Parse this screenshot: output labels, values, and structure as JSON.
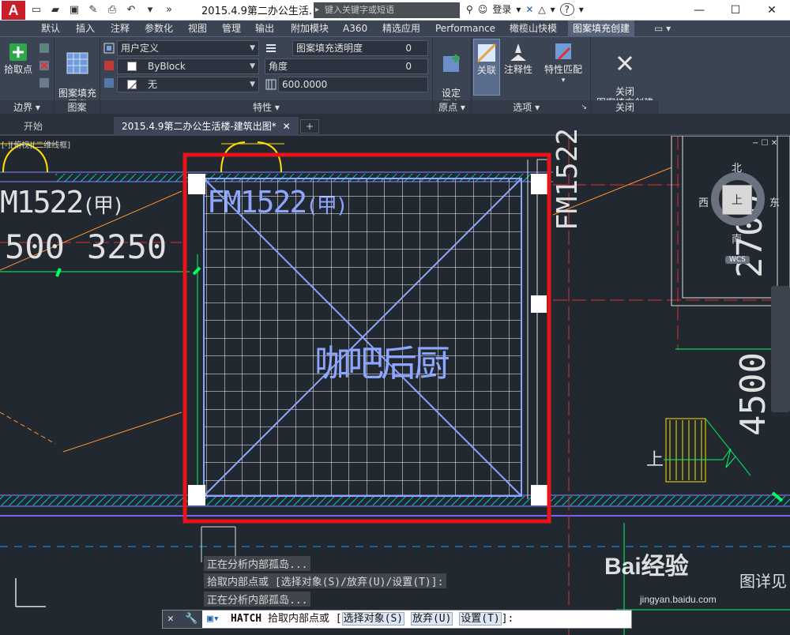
{
  "title_bar": {
    "app_logo": "A",
    "document_title": "2015.4.9第二办公生活...",
    "search_placeholder": "键入关键字或短语",
    "login_label": "登录",
    "help_label": "?"
  },
  "ribbon_tabs": [
    "默认",
    "插入",
    "注释",
    "参数化",
    "视图",
    "管理",
    "输出",
    "附加模块",
    "A360",
    "精选应用",
    "Performance",
    "橄榄山快模",
    "图案填充创建"
  ],
  "active_ribbon_tab": "图案填充创建",
  "ribbon": {
    "boundary": {
      "pick_points_label": "拾取点",
      "panel_label": "边界"
    },
    "pattern": {
      "hatch_pattern_label": "图案填充\n图案",
      "panel_label": "图案"
    },
    "properties": {
      "pattern_type": "用户定义",
      "color": "ByBlock",
      "background": "无",
      "transparency_label": "图案填充透明度",
      "transparency_value": "0",
      "angle_label": "角度",
      "angle_value": "0",
      "spacing_value": "600.0000",
      "panel_label": "特性"
    },
    "origin": {
      "set_origin_label": "设定\n原点",
      "panel_label": "原点"
    },
    "options": {
      "associative_label": "关联",
      "annotative_label": "注释性",
      "match_properties_label": "特性匹配",
      "panel_label": "选项"
    },
    "close": {
      "close_label": "关闭\n图案填充创建",
      "panel_label": "关闭"
    }
  },
  "document_tabs": {
    "start_tab": "开始",
    "active_tab": "2015.4.9第二办公生活楼-建筑出图*"
  },
  "viewport_label": "[-][俯视][二维线框]",
  "drawing": {
    "door_label_main": "FM1522",
    "door_label_main_suffix": "(甲)",
    "door_label_left": "M1522",
    "door_label_left_suffix": "(甲)",
    "dim_left_1": "500",
    "dim_left_2": "3250",
    "room_name": "咖吧后厨",
    "door_label_right": "FM1522",
    "dim_right_1": "2700",
    "dim_right_2": "4500",
    "stair_label": "上"
  },
  "viewcube": {
    "north": "北",
    "south": "南",
    "east": "东",
    "west": "西",
    "top": "上",
    "wcs": "WCS"
  },
  "command_history": [
    "正在分析内部孤岛...",
    "拾取内部点或 [选择对象(S)/放弃(U)/设置(T)]:",
    "正在分析内部孤岛..."
  ],
  "command_line": {
    "command": "HATCH",
    "prompt": "拾取内部点或 [",
    "option_1": "选择对象(S)",
    "option_2": "放弃(U)",
    "option_3": "设置(T)",
    "end": "]:"
  },
  "watermark": {
    "brand": "Bai经验",
    "url": "jingyan.baidu.com",
    "side_text": "图详见"
  },
  "colors": {
    "highlight_red": "#e8141c",
    "hatch_white": "#ffffff",
    "selection_blue": "#8fa6ff",
    "wall_cyan": "#00c8d0",
    "axis_red": "#e03030"
  }
}
